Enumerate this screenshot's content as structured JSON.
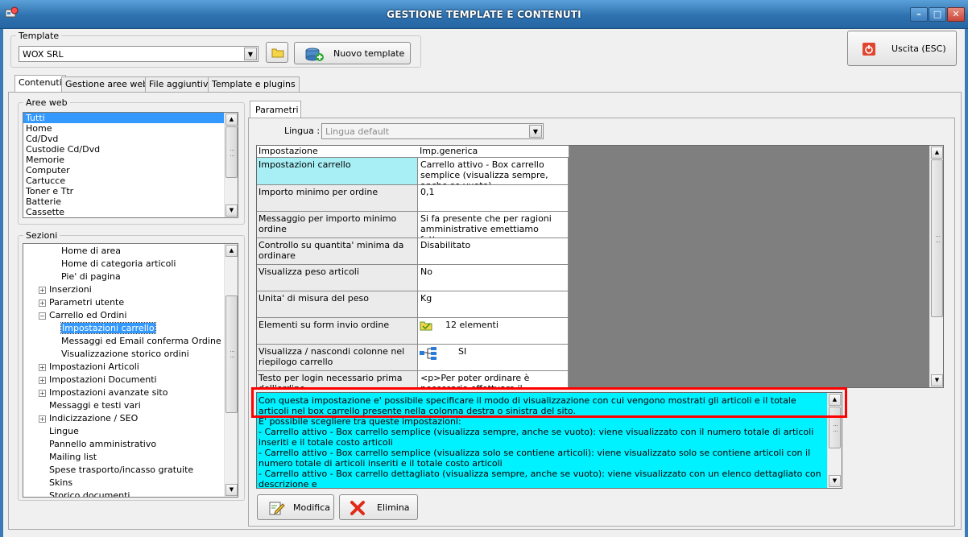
{
  "window": {
    "title": "GESTIONE TEMPLATE E CONTENUTI",
    "controls": {
      "minimize": "–",
      "maximize": "□",
      "close": "✕"
    }
  },
  "template_group": {
    "legend": "Template",
    "selected": "WOX SRL",
    "new_button": "Nuovo template"
  },
  "exit_button": "Uscita (ESC)",
  "tabs": [
    "Contenuti",
    "Gestione aree web",
    "File aggiuntivi",
    "Template e plugins"
  ],
  "aree_web": {
    "legend": "Aree web",
    "items": [
      "Tutti",
      "Home",
      "Cd/Dvd",
      "Custodie Cd/Dvd",
      "Memorie",
      "Computer",
      "Cartucce",
      "Toner e Ttr",
      "Batterie",
      "Cassette"
    ]
  },
  "sezioni": {
    "legend": "Sezioni",
    "nodes": [
      {
        "label": "Home di area",
        "level": 2,
        "exp": ""
      },
      {
        "label": "Home di categoria articoli",
        "level": 2,
        "exp": ""
      },
      {
        "label": "Pie' di pagina",
        "level": 2,
        "exp": ""
      },
      {
        "label": "Inserzioni",
        "level": 1,
        "exp": "+"
      },
      {
        "label": "Parametri utente",
        "level": 1,
        "exp": "+"
      },
      {
        "label": "Carrello ed Ordini",
        "level": 1,
        "exp": "−"
      },
      {
        "label": "Impostazioni carrello",
        "level": 2,
        "exp": "",
        "selected": true
      },
      {
        "label": "Messaggi ed Email conferma Ordine",
        "level": 2,
        "exp": ""
      },
      {
        "label": "Visualizzazione storico ordini",
        "level": 2,
        "exp": ""
      },
      {
        "label": "Impostazioni Articoli",
        "level": 1,
        "exp": "+"
      },
      {
        "label": "Impostazioni Documenti",
        "level": 1,
        "exp": "+"
      },
      {
        "label": "Impostazioni avanzate sito",
        "level": 1,
        "exp": "+"
      },
      {
        "label": "Messaggi e testi vari",
        "level": 1,
        "exp": ""
      },
      {
        "label": "Indicizzazione / SEO",
        "level": 1,
        "exp": "+"
      },
      {
        "label": "Lingue",
        "level": 1,
        "exp": ""
      },
      {
        "label": "Pannello amministrativo",
        "level": 1,
        "exp": ""
      },
      {
        "label": "Mailing list",
        "level": 1,
        "exp": ""
      },
      {
        "label": "Spese trasporto/incasso gratuite",
        "level": 1,
        "exp": ""
      },
      {
        "label": "Skins",
        "level": 1,
        "exp": ""
      },
      {
        "label": "Storico documenti",
        "level": 1,
        "exp": ""
      }
    ]
  },
  "parametri": {
    "tab": "Parametri",
    "lingua_label": "Lingua :",
    "lingua_value": "Lingua default",
    "columns": [
      "Impostazione",
      "Imp.generica"
    ],
    "rows": [
      {
        "name": "Impostazioni carrello",
        "value": "Carrello attivo - Box carrello semplice (visualizza sempre, anche se vuoto)",
        "highlight": true
      },
      {
        "name": "Importo minimo per ordine",
        "value": "0,1"
      },
      {
        "name": "Messaggio per importo minimo ordine",
        "value": "Si fa presente che per ragioni amministrative emettiamo fattura a..."
      },
      {
        "name": "Controllo su quantita' minima da ordinare",
        "value": "Disabilitato"
      },
      {
        "name": "Visualizza peso articoli",
        "value": "No"
      },
      {
        "name": "Unita' di misura del peso",
        "value": "Kg"
      },
      {
        "name": "Elementi su form invio ordine",
        "value": "12 elementi",
        "icon": "folder-icon"
      },
      {
        "name": "Visualizza / nascondi colonne nel riepilogo carrello",
        "value": "SI",
        "icon": "columns-icon"
      },
      {
        "name": "Testo per login necessario prima dell'ordine",
        "value": "<p>Per poter ordinare è necessario effettuare il login</p>"
      }
    ],
    "description": "Con questa impostazione e' possibile specificare il modo di visualizzazione con cui vengono mostrati gli articoli e il totale articoli nel box carrello presente nella colonna destra o sinistra del sito.\nE' possibile scegliere tra queste impostazioni:\n- Carrello attivo - Box carrello semplice (visualizza sempre, anche se vuoto): viene visualizzato con il numero totale di articoli inseriti e il totale costo articoli\n- Carrello attivo - Box carrello semplice (visualizza solo se contiene articoli): viene visualizzato solo se contiene articoli con il numero totale di articoli inseriti e il totale costo articoli\n- Carrello attivo - Box carrello dettagliato (visualizza sempre, anche se vuoto): viene visualizzato con un elenco dettagliato con descrizione e"
  },
  "actions": {
    "edit": "Modifica",
    "delete": "Elimina"
  },
  "colors": {
    "titlebar": "#2f72b0",
    "selection": "#3399ff",
    "highlight": "#a8eff5",
    "description_bg": "#00f1ff",
    "red_outline": "#ff0000"
  }
}
